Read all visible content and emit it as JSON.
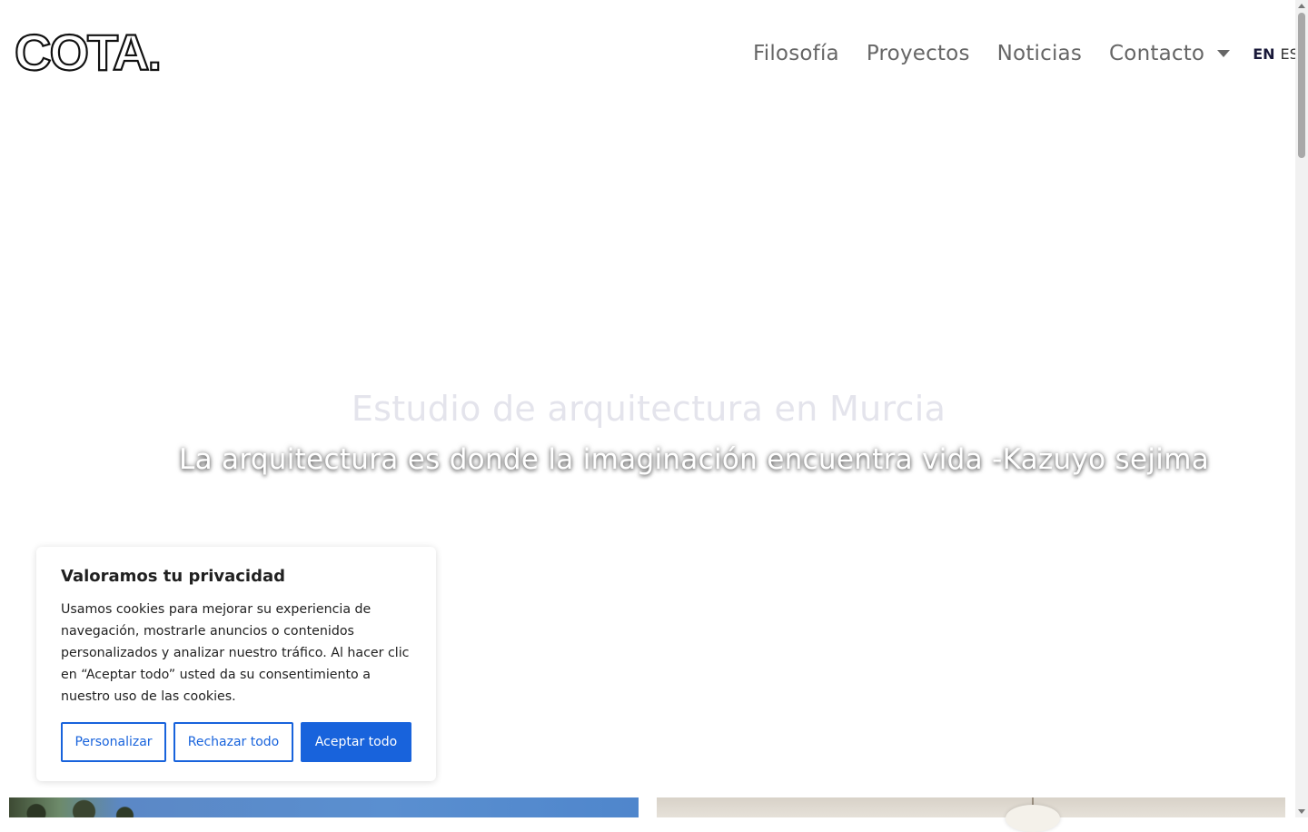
{
  "header": {
    "logo_text": "COTA.",
    "nav": {
      "filosofia": "Filosofía",
      "proyectos": "Proyectos",
      "noticias": "Noticias",
      "contacto": "Contacto"
    },
    "lang": {
      "en": "EN",
      "es": "ES"
    }
  },
  "hero": {
    "subtitle": "Estudio de arquitectura en Murcia",
    "quote": "La arquitectura es donde la imaginación encuentra vida -Kazuyo sejima"
  },
  "cookie": {
    "title": "Valoramos tu privacidad",
    "body": "Usamos cookies para mejorar su experiencia de navegación, mostrarle anuncios o contenidos personalizados y analizar nuestro tráfico. Al hacer clic en “Aceptar todo” usted da su consentimiento a nuestro uso de las cookies.",
    "customize": "Personalizar",
    "reject": "Rechazar todo",
    "accept": "Aceptar todo"
  },
  "colors": {
    "accent": "#1863dc",
    "nav_text": "#666666",
    "hero_subtitle": "#e4e4ec"
  },
  "icons": {
    "dropdown": "chevron-down-icon"
  }
}
